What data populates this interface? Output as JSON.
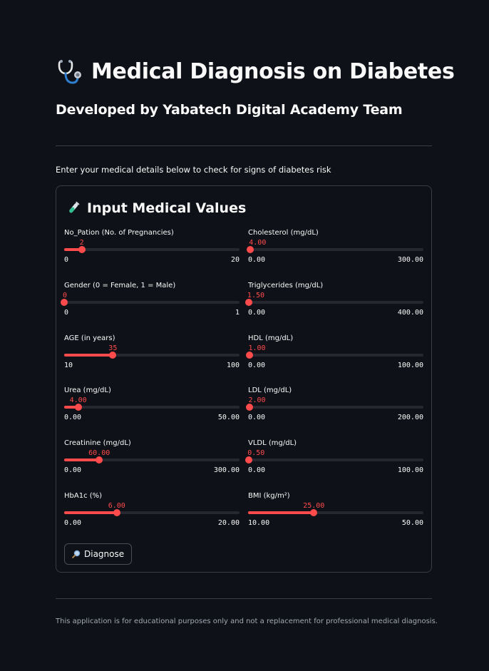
{
  "header": {
    "title": "Medical Diagnosis on Diabetes",
    "title_icon": "stethoscope-icon",
    "subtitle": "Developed by Yabatech Digital Academy Team"
  },
  "intro": "Enter your medical details below to check for signs of diabetes risk",
  "form": {
    "heading": "Input Medical Values",
    "heading_icon": "test-tube-icon",
    "sliders": [
      {
        "id": "no-pation",
        "label": "No_Pation (No. of Pregnancies)",
        "value": "2",
        "num": 2,
        "min_label": "0",
        "max_label": "20",
        "min": 0,
        "max": 20
      },
      {
        "id": "cholesterol",
        "label": "Cholesterol (mg/dL)",
        "value": "4.00",
        "num": 4,
        "min_label": "0.00",
        "max_label": "300.00",
        "min": 0,
        "max": 300
      },
      {
        "id": "gender",
        "label": "Gender (0 = Female, 1 = Male)",
        "value": "0",
        "num": 0,
        "min_label": "0",
        "max_label": "1",
        "min": 0,
        "max": 1
      },
      {
        "id": "triglycerides",
        "label": "Triglycerides (mg/dL)",
        "value": "1.50",
        "num": 1.5,
        "min_label": "0.00",
        "max_label": "400.00",
        "min": 0,
        "max": 400
      },
      {
        "id": "age",
        "label": "AGE (in years)",
        "value": "35",
        "num": 35,
        "min_label": "10",
        "max_label": "100",
        "min": 10,
        "max": 100
      },
      {
        "id": "hdl",
        "label": "HDL (mg/dL)",
        "value": "1.00",
        "num": 1,
        "min_label": "0.00",
        "max_label": "100.00",
        "min": 0,
        "max": 100
      },
      {
        "id": "urea",
        "label": "Urea (mg/dL)",
        "value": "4.00",
        "num": 4,
        "min_label": "0.00",
        "max_label": "50.00",
        "min": 0,
        "max": 50
      },
      {
        "id": "ldl",
        "label": "LDL (mg/dL)",
        "value": "2.00",
        "num": 2,
        "min_label": "0.00",
        "max_label": "200.00",
        "min": 0,
        "max": 200
      },
      {
        "id": "creatinine",
        "label": "Creatinine (mg/dL)",
        "value": "60.00",
        "num": 60,
        "min_label": "0.00",
        "max_label": "300.00",
        "min": 0,
        "max": 300
      },
      {
        "id": "vldl",
        "label": "VLDL (mg/dL)",
        "value": "0.50",
        "num": 0.5,
        "min_label": "0.00",
        "max_label": "100.00",
        "min": 0,
        "max": 100
      },
      {
        "id": "hba1c",
        "label": "HbA1c (%)",
        "value": "6.00",
        "num": 6,
        "min_label": "0.00",
        "max_label": "20.00",
        "min": 0,
        "max": 20
      },
      {
        "id": "bmi",
        "label": "BMI (kg/m²)",
        "value": "25.00",
        "num": 25,
        "min_label": "10.00",
        "max_label": "50.00",
        "min": 10,
        "max": 50
      }
    ],
    "button": {
      "label": "Diagnose",
      "icon": "magnifier-icon"
    }
  },
  "footer": "This application is for educational purposes only and not a replacement for professional medical diagnosis.",
  "colors": {
    "accent": "#ff4b4b",
    "background": "#0e1117",
    "track": "#262730"
  }
}
